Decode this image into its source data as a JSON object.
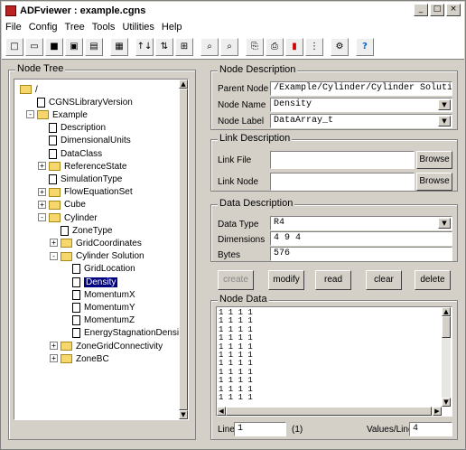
{
  "window": {
    "title": "ADFviewer : example.cgns",
    "minimize": "_",
    "maximize": "□",
    "close": "×"
  },
  "menu": [
    "File",
    "Config",
    "Tree",
    "Tools",
    "Utilities",
    "Help"
  ],
  "toolbar": [
    {
      "icon": "new-file-icon",
      "glyph": "□"
    },
    {
      "icon": "open-file-icon",
      "glyph": "▭"
    },
    {
      "icon": "save-icon",
      "glyph": "■"
    },
    {
      "icon": "close-file-icon",
      "glyph": "▣"
    },
    {
      "icon": "file-info-icon",
      "glyph": "▤"
    },
    {
      "icon": "print-icon",
      "glyph": "▦"
    },
    {
      "icon": "node-up-icon",
      "glyph": "↑↓"
    },
    {
      "icon": "node-link-icon",
      "glyph": "⇅"
    },
    {
      "icon": "node-tag-icon",
      "glyph": "⊞"
    },
    {
      "icon": "find-icon",
      "glyph": "⌕"
    },
    {
      "icon": "find-next-icon",
      "glyph": "⌕"
    },
    {
      "icon": "copy-icon",
      "glyph": "⎘"
    },
    {
      "icon": "paste-icon",
      "glyph": "⎙"
    },
    {
      "icon": "plot-icon",
      "glyph": "▮"
    },
    {
      "icon": "grid-icon",
      "glyph": "⋮"
    },
    {
      "icon": "config-icon",
      "glyph": "⚙"
    },
    {
      "icon": "help-icon",
      "glyph": "?"
    }
  ],
  "tree": {
    "title": "Node Tree",
    "nodes": [
      {
        "label": "/",
        "type": "folder",
        "depth": 0
      },
      {
        "label": "CGNSLibraryVersion",
        "type": "doc",
        "depth": 1
      },
      {
        "label": "Example",
        "type": "folder",
        "depth": 1,
        "expander": "-"
      },
      {
        "label": "Description",
        "type": "doc",
        "depth": 2
      },
      {
        "label": "DimensionalUnits",
        "type": "doc",
        "depth": 2
      },
      {
        "label": "DataClass",
        "type": "doc",
        "depth": 2
      },
      {
        "label": "ReferenceState",
        "type": "folder",
        "depth": 2,
        "expander": "+"
      },
      {
        "label": "SimulationType",
        "type": "doc",
        "depth": 2
      },
      {
        "label": "FlowEquationSet",
        "type": "folder",
        "depth": 2,
        "expander": "+"
      },
      {
        "label": "Cube",
        "type": "folder",
        "depth": 2,
        "expander": "+"
      },
      {
        "label": "Cylinder",
        "type": "folder",
        "depth": 2,
        "expander": "-"
      },
      {
        "label": "ZoneType",
        "type": "doc",
        "depth": 3
      },
      {
        "label": "GridCoordinates",
        "type": "folder",
        "depth": 3,
        "expander": "+"
      },
      {
        "label": "Cylinder Solution",
        "type": "folder",
        "depth": 3,
        "expander": "-"
      },
      {
        "label": "GridLocation",
        "type": "doc",
        "depth": 4
      },
      {
        "label": "Density",
        "type": "doc",
        "depth": 4,
        "selected": true
      },
      {
        "label": "MomentumX",
        "type": "doc",
        "depth": 4
      },
      {
        "label": "MomentumY",
        "type": "doc",
        "depth": 4
      },
      {
        "label": "MomentumZ",
        "type": "doc",
        "depth": 4
      },
      {
        "label": "EnergyStagnationDensity",
        "type": "doc",
        "depth": 4
      },
      {
        "label": "ZoneGridConnectivity",
        "type": "folder",
        "depth": 3,
        "expander": "+"
      },
      {
        "label": "ZoneBC",
        "type": "folder",
        "depth": 3,
        "expander": "+"
      }
    ]
  },
  "node_description": {
    "title": "Node Description",
    "parent_label": "Parent Node",
    "parent_value": "/Example/Cylinder/Cylinder Solution",
    "name_label": "Node Name",
    "name_value": "Density",
    "node_label_label": "Node Label",
    "node_label_value": "DataArray_t"
  },
  "link_description": {
    "title": "Link Description",
    "file_label": "Link File",
    "file_value": "",
    "browse1": "Browse",
    "node_label": "Link Node",
    "node_value": "",
    "browse2": "Browse"
  },
  "data_description": {
    "title": "Data Description",
    "type_label": "Data Type",
    "type_value": "R4",
    "dims_label": "Dimensions",
    "dims_value": "4 9 4",
    "bytes_label": "Bytes",
    "bytes_value": "576"
  },
  "actions": {
    "create": "create",
    "modify": "modify",
    "read": "read",
    "clear": "clear",
    "delete": "delete"
  },
  "node_data": {
    "title": "Node Data",
    "text": "1 1 1 1\n1 1 1 1\n1 1 1 1\n1 1 1 1\n1 1 1 1\n1 1 1 1\n1 1 1 1\n1 1 1 1\n1 1 1 1\n1 1 1 1\n1 1 1 1",
    "line_label": "Line",
    "line_value": "1",
    "line_count": "(1)",
    "vpl_label": "Values/Line",
    "vpl_value": "4"
  }
}
